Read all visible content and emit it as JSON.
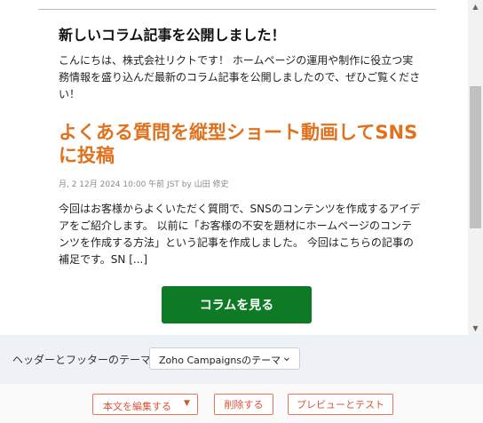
{
  "email": {
    "heading": "新しいコラム記事を公開しました！",
    "intro": "こんにちは、株式会社リクトです！ ホームページの運用や制作に役立つ実務情報を盛り込んだ最新のコラム記事を公開しましたので、ぜひご覧ください！",
    "article_title": "よくある質問を縦型ショート動画してSNSに投稿",
    "meta": "月, 2 12月 2024 10:00 午前 JST by 山田 修史",
    "excerpt": "今回はお客様からよくいただく質問で、SNSのコンテンツを作成するアイデアをご紹介します。 以前に「お客様の不安を題材にホームページのコンテンツを作成する方法」という記事を作成しました。 今回はこちらの記事の補足です。SN [...]",
    "cta_label": "コラムを見る"
  },
  "theme": {
    "label": "ヘッダーとフッターのテーマ",
    "selected": "Zoho Campaignsのテーマ"
  },
  "actions": {
    "edit_label": "本文を編集する",
    "delete_label": "削除する",
    "preview_label": "プレビューとテスト"
  },
  "colors": {
    "accent": "#e0711e",
    "cta": "#0f7a26",
    "button_border": "#e8765a"
  },
  "icons": {
    "scroll_up": "triangle-up",
    "scroll_down": "triangle-down",
    "select": "chevron-down",
    "edit_menu": "caret-down"
  }
}
